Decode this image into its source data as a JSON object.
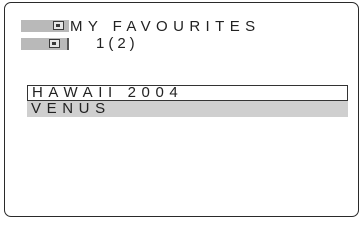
{
  "header": {
    "title": "MY FAVOURITES",
    "page_indicator": "1(2)",
    "icons": [
      "album-icon",
      "folder-icon"
    ]
  },
  "list": {
    "items": [
      {
        "label": "HAWAII 2004",
        "state": "cursor"
      },
      {
        "label": "VENUS",
        "state": "highlighted"
      }
    ]
  },
  "colors": {
    "highlight": "#cfcfcf",
    "icon_box": "#b9b9b9",
    "border": "#2a2a2a"
  }
}
